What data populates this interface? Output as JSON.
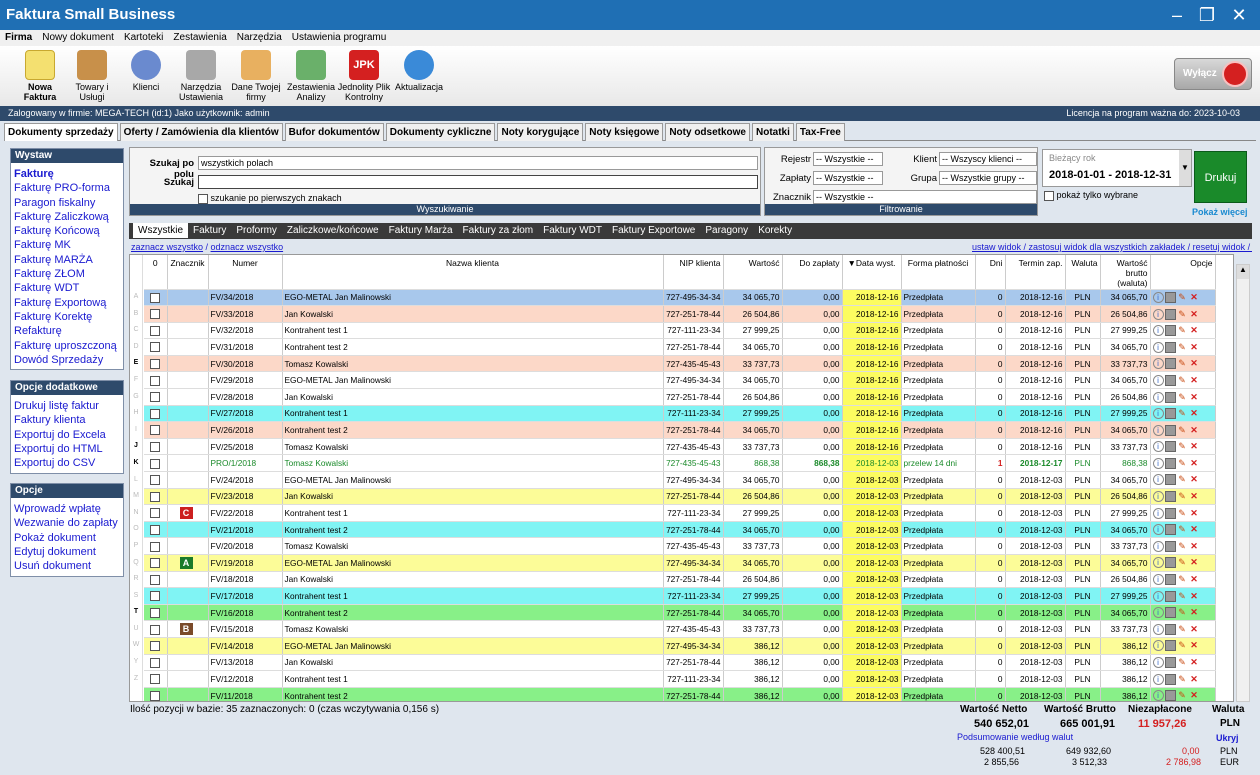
{
  "app": {
    "title": "Faktura Small Business"
  },
  "menu": [
    "Firma",
    "Nowy dokument",
    "Kartoteki",
    "Zestawienia",
    "Narzędzia",
    "Ustawienia programu"
  ],
  "toolbar": [
    {
      "label": "Nowa Faktura",
      "icon": "new-invoice-icon"
    },
    {
      "label": "Towary i Usługi",
      "icon": "boxes-icon"
    },
    {
      "label": "Klienci",
      "icon": "clients-icon"
    },
    {
      "label": "Narzędzia Ustawienia",
      "icon": "tools-icon"
    },
    {
      "label": "Dane Twojej firmy",
      "icon": "company-icon"
    },
    {
      "label": "Zestawienia Analizy",
      "icon": "reports-icon"
    },
    {
      "label": "Jednolity Plik Kontrolny",
      "icon": "jpk-icon"
    },
    {
      "label": "Aktualizacja",
      "icon": "update-icon"
    }
  ],
  "exit": {
    "label": "Wyłącz"
  },
  "info": {
    "login": "Zalogowany w firmie: MEGA-TECH (id:1) Jako użytkownik: admin",
    "license": "Licencja na program ważna do: 2023-10-03"
  },
  "tabs": [
    "Dokumenty sprzedaży",
    "Oferty / Zamówienia dla klientów",
    "Bufor dokumentów",
    "Dokumenty cykliczne",
    "Noty korygujące",
    "Noty księgowe",
    "Noty odsetkowe",
    "Notatki",
    "Tax-Free"
  ],
  "panels": {
    "wystaw": {
      "title": "Wystaw",
      "items": [
        "Fakturę",
        "Fakturę PRO-forma",
        "Paragon fiskalny",
        "Fakturę Zaliczkową",
        "Fakturę Końcową",
        "Fakturę MK",
        "Fakturę MARŻA",
        "Fakturę ZŁOM",
        "Fakturę WDT",
        "Fakturę Exportową",
        "Fakturę Korektę",
        "Refakturę",
        "Fakturę uproszczoną",
        "Dowód Sprzedaży"
      ]
    },
    "opcje_dod": {
      "title": "Opcje dodatkowe",
      "items": [
        "Drukuj listę faktur",
        "Faktury klienta",
        "Exportuj do Excela",
        "Exportuj do HTML",
        "Exportuj do CSV"
      ]
    },
    "opcje": {
      "title": "Opcje",
      "items": [
        "Wprowadź wpłatę",
        "Wezwanie do zapłaty",
        "Pokaż dokument",
        "Edytuj dokument",
        "Usuń dokument"
      ]
    }
  },
  "search": {
    "field_label": "Szukaj po polu",
    "field_value": "wszystkich polach",
    "search_label": "Szukaj",
    "search_value": "",
    "first_chars": "szukanie po pierwszych znakach",
    "footer": "Wyszukiwanie"
  },
  "filter": {
    "rejestr_label": "Rejestr",
    "rejestr": "-- Wszystkie --",
    "zaplaty_label": "Zapłaty",
    "zaplaty": "-- Wszystkie --",
    "klient_label": "Klient",
    "klient": "-- Wszyscy klienci --",
    "grupa_label": "Grupa",
    "grupa": "-- Wszystkie grupy --",
    "znacznik_label": "Znacznik",
    "znacznik": "-- Wszystkie --",
    "footer": "Filtrowanie",
    "show_selected": "pokaż tylko wybrane",
    "show_more": "Pokaż więcej"
  },
  "year": {
    "label": "Bieżący rok",
    "range": "2018-01-01 - 2018-12-31"
  },
  "print": {
    "label": "Drukuj"
  },
  "subtabs": [
    "Wszystkie",
    "Faktury",
    "Proformy",
    "Zaliczkowe/końcowe",
    "Faktury Marża",
    "Faktury za złom",
    "Faktury WDT",
    "Faktury Exportowe",
    "Paragony",
    "Korekty"
  ],
  "links": {
    "select_all": "zaznacz wszystko",
    "deselect_all": "odznacz wszystko",
    "right": "ustaw widok / zastosuj widok dla wszystkich zakładek / resetuj widok / odśwież"
  },
  "alpha": [
    "A",
    "B",
    "C",
    "D",
    "E",
    "F",
    "G",
    "H",
    "I",
    "J",
    "K",
    "L",
    "M",
    "N",
    "O",
    "P",
    "Q",
    "R",
    "S",
    "T",
    "U",
    "W",
    "Y",
    "Z"
  ],
  "columns": [
    "0",
    "Znacznik",
    "Numer",
    "Nazwa klienta",
    "NIP klienta",
    "Wartość",
    "Do zapłaty",
    "▼Data wyst.",
    "Forma płatności",
    "Dni",
    "Termin zap.",
    "Waluta",
    "Wartość brutto (waluta)",
    "Opcje"
  ],
  "rows": [
    {
      "bg": "#a8c8ec",
      "mark": "",
      "num": "FV/34/2018",
      "client": "EGO-METAL Jan Malinowski",
      "nip": "727-495-34-34",
      "val": "34 065,70",
      "due": "0,00",
      "date": "2018-12-16",
      "pay": "Przedpłata",
      "days": "0",
      "term": "2018-12-16",
      "cur": "PLN",
      "gross": "34 065,70"
    },
    {
      "bg": "#fcd8c8",
      "mark": "",
      "num": "FV/33/2018",
      "client": "Jan Kowalski",
      "nip": "727-251-78-44",
      "val": "26 504,86",
      "due": "0,00",
      "date": "2018-12-16",
      "pay": "Przedpłata",
      "days": "0",
      "term": "2018-12-16",
      "cur": "PLN",
      "gross": "26 504,86"
    },
    {
      "bg": "#ffffff",
      "mark": "",
      "num": "FV/32/2018",
      "client": "Kontrahent test 1",
      "nip": "727-111-23-34",
      "val": "27 999,25",
      "due": "0,00",
      "date": "2018-12-16",
      "pay": "Przedpłata",
      "days": "0",
      "term": "2018-12-16",
      "cur": "PLN",
      "gross": "27 999,25"
    },
    {
      "bg": "#ffffff",
      "mark": "",
      "num": "FV/31/2018",
      "client": "Kontrahent test 2",
      "nip": "727-251-78-44",
      "val": "34 065,70",
      "due": "0,00",
      "date": "2018-12-16",
      "pay": "Przedpłata",
      "days": "0",
      "term": "2018-12-16",
      "cur": "PLN",
      "gross": "34 065,70"
    },
    {
      "bg": "#fcd8c8",
      "mark": "",
      "num": "FV/30/2018",
      "client": "Tomasz Kowalski",
      "nip": "727-435-45-43",
      "val": "33 737,73",
      "due": "0,00",
      "date": "2018-12-16",
      "pay": "Przedpłata",
      "days": "0",
      "term": "2018-12-16",
      "cur": "PLN",
      "gross": "33 737,73"
    },
    {
      "bg": "#ffffff",
      "mark": "",
      "num": "FV/29/2018",
      "client": "EGO-METAL Jan Malinowski",
      "nip": "727-495-34-34",
      "val": "34 065,70",
      "due": "0,00",
      "date": "2018-12-16",
      "pay": "Przedpłata",
      "days": "0",
      "term": "2018-12-16",
      "cur": "PLN",
      "gross": "34 065,70"
    },
    {
      "bg": "#ffffff",
      "mark": "",
      "num": "FV/28/2018",
      "client": "Jan Kowalski",
      "nip": "727-251-78-44",
      "val": "26 504,86",
      "due": "0,00",
      "date": "2018-12-16",
      "pay": "Przedpłata",
      "days": "0",
      "term": "2018-12-16",
      "cur": "PLN",
      "gross": "26 504,86"
    },
    {
      "bg": "#80f4f4",
      "mark": "",
      "num": "FV/27/2018",
      "client": "Kontrahent test 1",
      "nip": "727-111-23-34",
      "val": "27 999,25",
      "due": "0,00",
      "date": "2018-12-16",
      "pay": "Przedpłata",
      "days": "0",
      "term": "2018-12-16",
      "cur": "PLN",
      "gross": "27 999,25"
    },
    {
      "bg": "#fcd8c8",
      "mark": "",
      "num": "FV/26/2018",
      "client": "Kontrahent test 2",
      "nip": "727-251-78-44",
      "val": "34 065,70",
      "due": "0,00",
      "date": "2018-12-16",
      "pay": "Przedpłata",
      "days": "0",
      "term": "2018-12-16",
      "cur": "PLN",
      "gross": "34 065,70"
    },
    {
      "bg": "#ffffff",
      "mark": "",
      "num": "FV/25/2018",
      "client": "Tomasz Kowalski",
      "nip": "727-435-45-43",
      "val": "33 737,73",
      "due": "0,00",
      "date": "2018-12-16",
      "pay": "Przedpłata",
      "days": "0",
      "term": "2018-12-16",
      "cur": "PLN",
      "gross": "33 737,73"
    },
    {
      "bg": "#ffffff",
      "mark": "",
      "num": "PRO/1/2018",
      "client": "Tomasz Kowalski",
      "nip": "727-435-45-43",
      "val": "868,38",
      "due": "868,38",
      "date": "2018-12-03",
      "pay": "przelew 14 dni",
      "days": "1",
      "term": "2018-12-17",
      "cur": "PLN",
      "gross": "868,38",
      "green": true
    },
    {
      "bg": "#ffffff",
      "mark": "",
      "num": "FV/24/2018",
      "client": "EGO-METAL Jan Malinowski",
      "nip": "727-495-34-34",
      "val": "34 065,70",
      "due": "0,00",
      "date": "2018-12-03",
      "pay": "Przedpłata",
      "days": "0",
      "term": "2018-12-03",
      "cur": "PLN",
      "gross": "34 065,70"
    },
    {
      "bg": "#fcfc98",
      "mark": "",
      "num": "FV/23/2018",
      "client": "Jan Kowalski",
      "nip": "727-251-78-44",
      "val": "26 504,86",
      "due": "0,00",
      "date": "2018-12-03",
      "pay": "Przedpłata",
      "days": "0",
      "term": "2018-12-03",
      "cur": "PLN",
      "gross": "26 504,86"
    },
    {
      "bg": "#ffffff",
      "mark": "C",
      "mcol": "#cc2020",
      "num": "FV/22/2018",
      "client": "Kontrahent test 1",
      "nip": "727-111-23-34",
      "val": "27 999,25",
      "due": "0,00",
      "date": "2018-12-03",
      "pay": "Przedpłata",
      "days": "0",
      "term": "2018-12-03",
      "cur": "PLN",
      "gross": "27 999,25"
    },
    {
      "bg": "#80f4f4",
      "mark": "",
      "num": "FV/21/2018",
      "client": "Kontrahent test 2",
      "nip": "727-251-78-44",
      "val": "34 065,70",
      "due": "0,00",
      "date": "2018-12-03",
      "pay": "Przedpłata",
      "days": "0",
      "term": "2018-12-03",
      "cur": "PLN",
      "gross": "34 065,70"
    },
    {
      "bg": "#ffffff",
      "mark": "",
      "num": "FV/20/2018",
      "client": "Tomasz Kowalski",
      "nip": "727-435-45-43",
      "val": "33 737,73",
      "due": "0,00",
      "date": "2018-12-03",
      "pay": "Przedpłata",
      "days": "0",
      "term": "2018-12-03",
      "cur": "PLN",
      "gross": "33 737,73"
    },
    {
      "bg": "#fcfc98",
      "mark": "A",
      "mcol": "#1a7a2a",
      "num": "FV/19/2018",
      "client": "EGO-METAL Jan Malinowski",
      "nip": "727-495-34-34",
      "val": "34 065,70",
      "due": "0,00",
      "date": "2018-12-03",
      "pay": "Przedpłata",
      "days": "0",
      "term": "2018-12-03",
      "cur": "PLN",
      "gross": "34 065,70"
    },
    {
      "bg": "#ffffff",
      "mark": "",
      "num": "FV/18/2018",
      "client": "Jan Kowalski",
      "nip": "727-251-78-44",
      "val": "26 504,86",
      "due": "0,00",
      "date": "2018-12-03",
      "pay": "Przedpłata",
      "days": "0",
      "term": "2018-12-03",
      "cur": "PLN",
      "gross": "26 504,86"
    },
    {
      "bg": "#80f4f4",
      "mark": "",
      "num": "FV/17/2018",
      "client": "Kontrahent test 1",
      "nip": "727-111-23-34",
      "val": "27 999,25",
      "due": "0,00",
      "date": "2018-12-03",
      "pay": "Przedpłata",
      "days": "0",
      "term": "2018-12-03",
      "cur": "PLN",
      "gross": "27 999,25"
    },
    {
      "bg": "#88f088",
      "mark": "",
      "num": "FV/16/2018",
      "client": "Kontrahent test 2",
      "nip": "727-251-78-44",
      "val": "34 065,70",
      "due": "0,00",
      "date": "2018-12-03",
      "pay": "Przedpłata",
      "days": "0",
      "term": "2018-12-03",
      "cur": "PLN",
      "gross": "34 065,70"
    },
    {
      "bg": "#ffffff",
      "mark": "B",
      "mcol": "#7a4a2a",
      "num": "FV/15/2018",
      "client": "Tomasz Kowalski",
      "nip": "727-435-45-43",
      "val": "33 737,73",
      "due": "0,00",
      "date": "2018-12-03",
      "pay": "Przedpłata",
      "days": "0",
      "term": "2018-12-03",
      "cur": "PLN",
      "gross": "33 737,73"
    },
    {
      "bg": "#fcfc98",
      "mark": "",
      "num": "FV/14/2018",
      "client": "EGO-METAL Jan Malinowski",
      "nip": "727-495-34-34",
      "val": "386,12",
      "due": "0,00",
      "date": "2018-12-03",
      "pay": "Przedpłata",
      "days": "0",
      "term": "2018-12-03",
      "cur": "PLN",
      "gross": "386,12"
    },
    {
      "bg": "#ffffff",
      "mark": "",
      "num": "FV/13/2018",
      "client": "Jan Kowalski",
      "nip": "727-251-78-44",
      "val": "386,12",
      "due": "0,00",
      "date": "2018-12-03",
      "pay": "Przedpłata",
      "days": "0",
      "term": "2018-12-03",
      "cur": "PLN",
      "gross": "386,12"
    },
    {
      "bg": "#ffffff",
      "mark": "",
      "num": "FV/12/2018",
      "client": "Kontrahent test 1",
      "nip": "727-111-23-34",
      "val": "386,12",
      "due": "0,00",
      "date": "2018-12-03",
      "pay": "Przedpłata",
      "days": "0",
      "term": "2018-12-03",
      "cur": "PLN",
      "gross": "386,12"
    },
    {
      "bg": "#88f088",
      "mark": "",
      "num": "FV/11/2018",
      "client": "Kontrahent test 2",
      "nip": "727-251-78-44",
      "val": "386,12",
      "due": "0,00",
      "date": "2018-12-03",
      "pay": "Przedpłata",
      "days": "0",
      "term": "2018-12-03",
      "cur": "PLN",
      "gross": "386,12"
    }
  ],
  "status": "Ilość pozycji w bazie: 35  zaznaczonych: 0  (czas wczytywania 0,156 s)",
  "summary": {
    "netto_label": "Wartość Netto",
    "brutto_label": "Wartość Brutto",
    "unpaid_label": "Niezapłacone",
    "cur_label": "Waluta",
    "netto": "540 652,01",
    "brutto": "665 001,91",
    "unpaid": "11 957,26",
    "cur": "PLN",
    "by_cur": "Podsumowanie według walut",
    "hide": "Ukryj",
    "rows": [
      {
        "n": "528 400,51",
        "b": "649 932,60",
        "u": "0,00",
        "c": "PLN"
      },
      {
        "n": "2 855,56",
        "b": "3 512,33",
        "u": "2 786,98",
        "c": "EUR"
      }
    ]
  },
  "colors": {
    "accent": "#1f6fb4",
    "dark": "#2e4a6b",
    "date_hl": "#fcfc60"
  }
}
